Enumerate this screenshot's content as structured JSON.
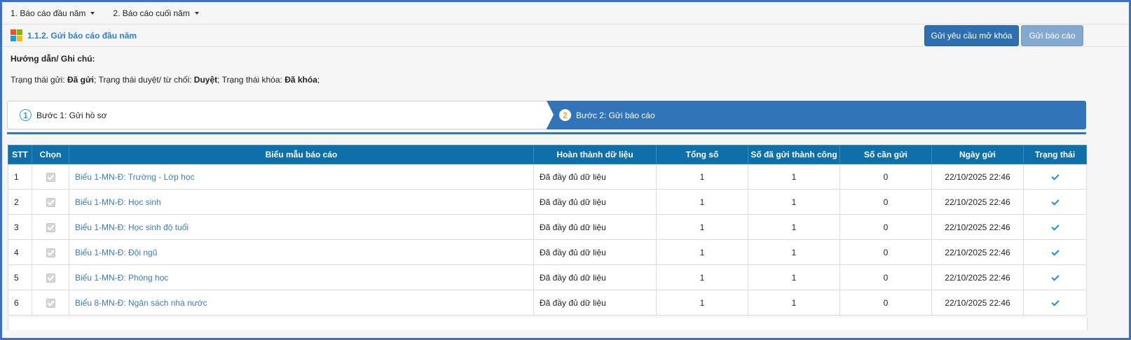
{
  "menu": [
    {
      "label": "1. Báo cáo đầu năm"
    },
    {
      "label": "2. Báo cáo cuối năm"
    }
  ],
  "header": {
    "title": "1.1.2. Gửi báo cáo đầu năm",
    "unlock_button": "Gửi yêu cầu mở khóa",
    "send_button": "Gửi báo cáo"
  },
  "guide": {
    "title": "Hướng dẫn/ Ghi chú:",
    "send_status_label": "Trạng thái gửi: ",
    "send_status_value": "Đã gửi",
    "approve_status_label": "; Trạng thái duyệt/ từ chối: ",
    "approve_status_value": "Duyệt",
    "lock_status_label": "; Trạng thái khóa: ",
    "lock_status_value": "Đã khóa",
    "end": ";"
  },
  "steps": [
    {
      "number": "1",
      "label": "Bước 1: Gửi hồ sơ"
    },
    {
      "number": "2",
      "label": "Bước 2: Gửi báo cáo"
    }
  ],
  "table": {
    "columns": [
      "STT",
      "Chọn",
      "Biểu mẫu báo cáo",
      "Hoàn thành dữ liệu",
      "Tổng số",
      "Số đã gửi thành công",
      "Số cần gửi",
      "Ngày gửi",
      "Trạng thái"
    ],
    "rows": [
      {
        "stt": "1",
        "form": "Biểu 1-MN-Đ: Trường - Lớp học",
        "completion": "Đã đầy đủ dữ liệu",
        "total": "1",
        "sent": "1",
        "pending": "0",
        "date": "22/10/2025 22:46",
        "checked": true,
        "status": "check-icon"
      },
      {
        "stt": "2",
        "form": "Biểu 1-MN-Đ: Học sinh",
        "completion": "Đã đầy đủ dữ liệu",
        "total": "1",
        "sent": "1",
        "pending": "0",
        "date": "22/10/2025 22:46",
        "checked": true,
        "status": "check-icon"
      },
      {
        "stt": "3",
        "form": "Biểu 1-MN-Đ: Học sinh độ tuổi",
        "completion": "Đã đầy đủ dữ liệu",
        "total": "1",
        "sent": "1",
        "pending": "0",
        "date": "22/10/2025 22:46",
        "checked": true,
        "status": "check-icon"
      },
      {
        "stt": "4",
        "form": "Biểu 1-MN-Đ: Đội ngũ",
        "completion": "Đã đầy đủ dữ liệu",
        "total": "1",
        "sent": "1",
        "pending": "0",
        "date": "22/10/2025 22:46",
        "checked": true,
        "status": "check-icon"
      },
      {
        "stt": "5",
        "form": "Biểu 1-MN-Đ: Phòng học",
        "completion": "Đã đầy đủ dữ liệu",
        "total": "1",
        "sent": "1",
        "pending": "0",
        "date": "22/10/2025 22:46",
        "checked": true,
        "status": "check-icon"
      },
      {
        "stt": "6",
        "form": "Biểu 8-MN-Đ: Ngân sách nhà nước",
        "completion": "Đã đầy đủ dữ liệu",
        "total": "1",
        "sent": "1",
        "pending": "0",
        "date": "22/10/2025 22:46",
        "checked": true,
        "status": "check-icon"
      }
    ]
  },
  "colors": {
    "frame_border": "#3b72c4",
    "header_bg": "#0f6fa8",
    "step_active": "#3174b8",
    "link": "#3a7abf",
    "check": "#1d8ed6"
  }
}
